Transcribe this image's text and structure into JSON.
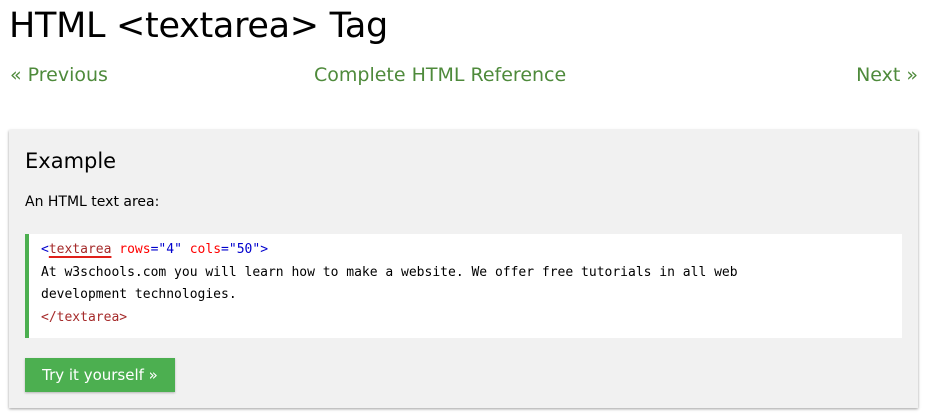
{
  "page": {
    "title": "HTML <textarea> Tag"
  },
  "nav": {
    "previous_label": "« Previous",
    "reference_label": "Complete HTML Reference",
    "next_label": "Next »",
    "link_color": "#4e8a3b"
  },
  "example": {
    "heading": "Example",
    "description": "An HTML text area:",
    "code": {
      "open_bracket": "<",
      "tag_name": "textarea",
      "attr1_name": "rows",
      "attr1_value": "\"4\"",
      "attr2_name": "cols",
      "attr2_value": "\"50\"",
      "close_bracket": ">",
      "text_line_1": "At w3schools.com you will learn how to make a website. We offer free tutorials in all web",
      "text_line_2": "development technologies.",
      "closing_tag": "</textarea>"
    },
    "try_button_label": "Try it yourself »",
    "accent_color": "#4caf50"
  }
}
